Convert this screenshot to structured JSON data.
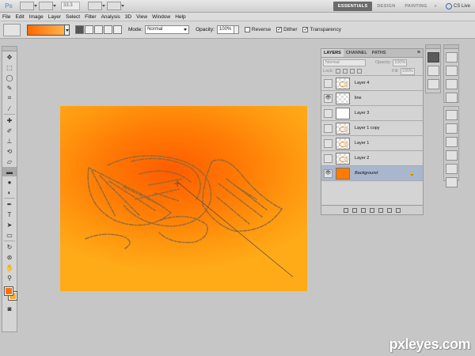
{
  "appbar": {
    "logo": "Ps",
    "zoom": "33.3",
    "workspaces": [
      "ESSENTIALS",
      "DESIGN",
      "PAINTING"
    ],
    "more": "»",
    "cslive": "CS Live"
  },
  "menu": [
    "File",
    "Edit",
    "Image",
    "Layer",
    "Select",
    "Filter",
    "Analysis",
    "3D",
    "View",
    "Window",
    "Help"
  ],
  "options": {
    "mode_label": "Mode:",
    "mode_value": "Normal",
    "opacity_label": "Opacity:",
    "opacity_value": "100%",
    "reverse_label": "Reverse",
    "dither_label": "Dither",
    "transparency_label": "Transparency",
    "reverse_checked": false,
    "dither_checked": true,
    "transparency_checked": true,
    "gradient_colors": [
      "#ff6a00",
      "#ffb24a"
    ]
  },
  "colors": {
    "foreground": "#ff7200",
    "background": "#ffae2e"
  },
  "tools": [
    "move-icon",
    "marquee-icon",
    "lasso-icon",
    "quick-select-icon",
    "crop-icon",
    "eyedropper-icon",
    "healing-icon",
    "brush-icon",
    "clone-stamp-icon",
    "history-brush-icon",
    "eraser-icon",
    "gradient-icon",
    "blur-icon",
    "dodge-icon",
    "pen-icon",
    "type-icon",
    "path-select-icon",
    "shape-icon",
    "3d-rotate-icon",
    "3d-orbit-icon",
    "hand-icon",
    "zoom-icon"
  ],
  "layers_panel": {
    "tabs": [
      "LAYERS",
      "CHANNEL",
      "PATHS"
    ],
    "blend_mode": "Normal",
    "opacity_label": "Opacity:",
    "opacity_value": "100%",
    "lock_label": "Lock:",
    "fill_label": "Fill:",
    "fill_value": "100%",
    "layers": [
      {
        "name": "Layer 4",
        "visible": false,
        "thumb": "sketch"
      },
      {
        "name": "line",
        "visible": true,
        "thumb": "transparent"
      },
      {
        "name": "Layer 3",
        "visible": false,
        "thumb": "white"
      },
      {
        "name": "Layer 1 copy",
        "visible": false,
        "thumb": "sketch"
      },
      {
        "name": "Layer 1",
        "visible": false,
        "thumb": "sketch"
      },
      {
        "name": "Layer 2",
        "visible": false,
        "thumb": "sketch"
      },
      {
        "name": "Background",
        "visible": true,
        "thumb": "orange",
        "selected": true,
        "locked": true
      }
    ]
  },
  "watermark": "pxleyes.com"
}
